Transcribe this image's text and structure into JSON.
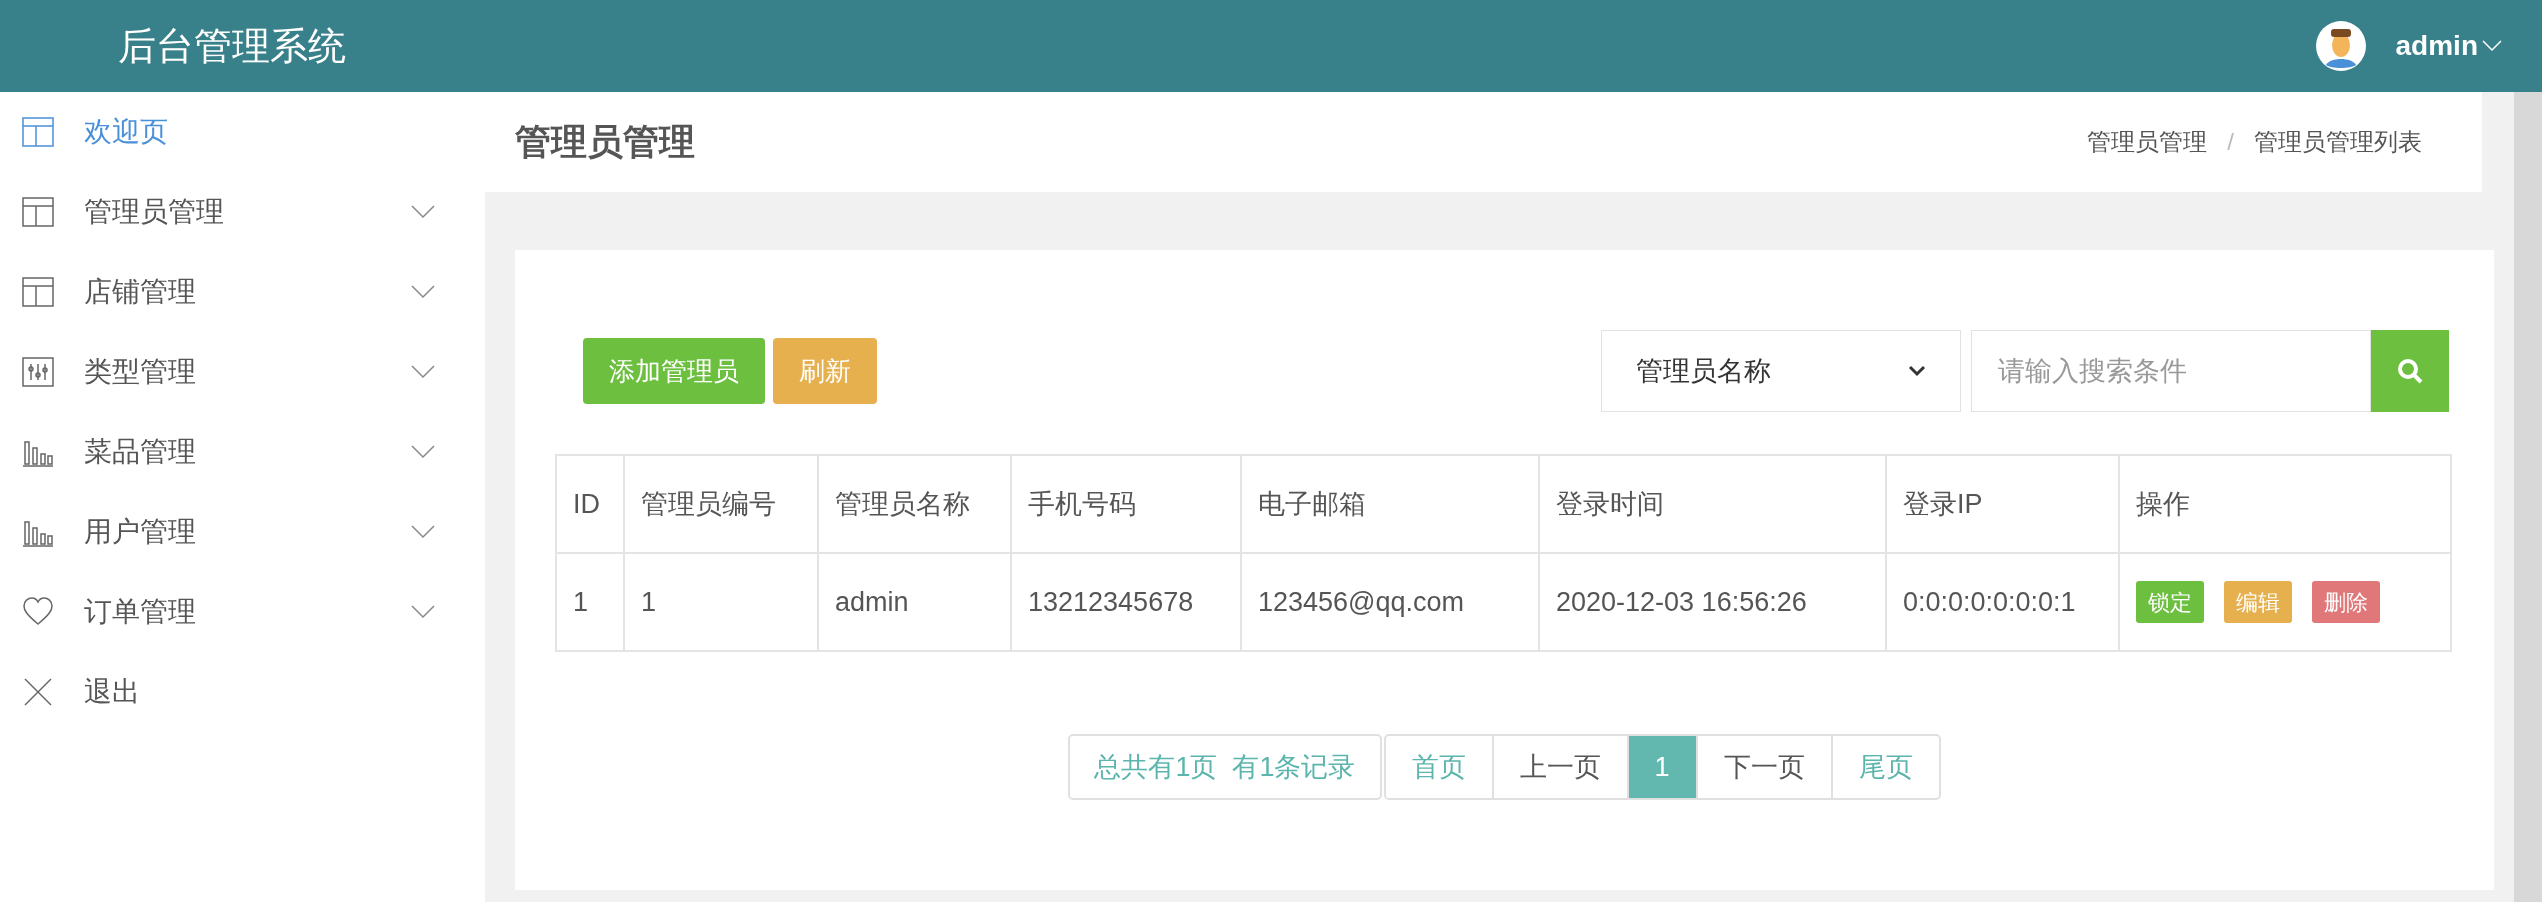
{
  "header": {
    "title": "后台管理系统",
    "user": "admin"
  },
  "sidebar": {
    "items": [
      {
        "label": "欢迎页",
        "kind": "layout",
        "selected": true,
        "expandable": false
      },
      {
        "label": "管理员管理",
        "kind": "layout",
        "selected": false,
        "expandable": true
      },
      {
        "label": "店铺管理",
        "kind": "layout",
        "selected": false,
        "expandable": true
      },
      {
        "label": "类型管理",
        "kind": "sliders",
        "selected": false,
        "expandable": true
      },
      {
        "label": "菜品管理",
        "kind": "bars",
        "selected": false,
        "expandable": true
      },
      {
        "label": "用户管理",
        "kind": "bars",
        "selected": false,
        "expandable": true
      },
      {
        "label": "订单管理",
        "kind": "heart",
        "selected": false,
        "expandable": true
      },
      {
        "label": "退出",
        "kind": "close",
        "selected": false,
        "expandable": false
      }
    ]
  },
  "page": {
    "title": "管理员管理",
    "breadcrumb": [
      "管理员管理",
      "管理员管理列表"
    ],
    "breadcrumb_separator": "/"
  },
  "toolbar": {
    "buttons": [
      {
        "label": "添加管理员",
        "kind": "success"
      },
      {
        "label": "刷新",
        "kind": "warning"
      }
    ],
    "search_select": "管理员名称",
    "search_placeholder": "请输入搜索条件"
  },
  "table": {
    "columns": [
      "ID",
      "管理员编号",
      "管理员名称",
      "手机号码",
      "电子邮箱",
      "登录时间",
      "登录IP",
      "操作"
    ],
    "rows": [
      {
        "cells": [
          "1",
          "1",
          "admin",
          "13212345678",
          "123456@qq.com",
          "2020-12-03 16:56:26",
          "0:0:0:0:0:0:0:1"
        ],
        "actions": [
          {
            "label": "锁定",
            "kind": "success"
          },
          {
            "label": "编辑",
            "kind": "warning"
          },
          {
            "label": "删除",
            "kind": "danger"
          }
        ]
      }
    ]
  },
  "pagination": {
    "summary": "总共有1页  有1条记录",
    "items": [
      {
        "label": "首页",
        "kind": "link",
        "selected": false
      },
      {
        "label": "上一页",
        "kind": "plain",
        "selected": false
      },
      {
        "label": "1",
        "kind": "page",
        "selected": true
      },
      {
        "label": "下一页",
        "kind": "plain",
        "selected": false
      },
      {
        "label": "尾页",
        "kind": "link",
        "selected": false
      }
    ]
  }
}
